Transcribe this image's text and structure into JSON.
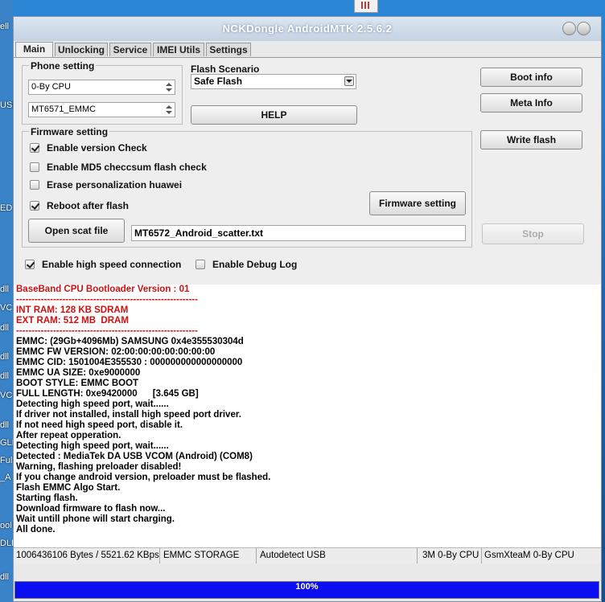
{
  "window": {
    "title": "NCKDongle AndroidMTK 2.5.6.2"
  },
  "tabs": [
    {
      "label": "Main"
    },
    {
      "label": "Unlocking"
    },
    {
      "label": "Service"
    },
    {
      "label": "IMEI Utils"
    },
    {
      "label": "Settings"
    }
  ],
  "phone_setting": {
    "label": "Phone setting",
    "cpu_value": "0-By CPU",
    "model_value": "MT6571_EMMC"
  },
  "flash_scenario": {
    "label": "Flash Scenario",
    "value": "Safe Flash"
  },
  "buttons": {
    "help": "HELP",
    "boot_info": "Boot info",
    "meta_info": "Meta Info",
    "write_flash": "Write flash",
    "firmware_setting": "Firmware setting",
    "open_scat_file": "Open scat file",
    "stop": "Stop"
  },
  "firmware_setting": {
    "label": "Firmware setting",
    "options": [
      {
        "label": "Enable version Check",
        "checked": true
      },
      {
        "label": "Enable MD5 checcsum flash check",
        "checked": false
      },
      {
        "label": "Erase personalization huawei",
        "checked": false
      },
      {
        "label": "Reboot after flash",
        "checked": true
      }
    ],
    "scatter_file": "MT6572_Android_scatter.txt"
  },
  "options": {
    "high_speed": {
      "label": "Enable high speed connection",
      "checked": true
    },
    "debug_log": {
      "label": "Enable Debug Log",
      "checked": false
    }
  },
  "log": [
    {
      "text": "BaseBand CPU Bootloader Version : 01",
      "red": true
    },
    {
      "text": "-----------------------------------------------------------",
      "red": true
    },
    {
      "text": "INT RAM: 128 KB SDRAM",
      "red": true
    },
    {
      "text": "EXT RAM: 512 MB  DRAM",
      "red": true
    },
    {
      "text": "-----------------------------------------------------------",
      "red": true
    },
    {
      "text": "EMMC: (29Gb+4096Mb) SAMSUNG 0x4e355530304d",
      "red": false
    },
    {
      "text": "EMMC FW VERSION: 02:00:00:00:00:00:00:00",
      "red": false
    },
    {
      "text": "EMMC CID: 1501004E355530 : 000000000000000000",
      "red": false
    },
    {
      "text": "EMMC UA SIZE: 0xe9000000",
      "red": false
    },
    {
      "text": "BOOT STYLE: EMMC BOOT",
      "red": false
    },
    {
      "text": "FULL LENGTH: 0xe9420000      [3.645 GB]",
      "red": false
    },
    {
      "text": "Detecting high speed port, wait......",
      "red": false
    },
    {
      "text": "If driver not installed, install high speed port driver.",
      "red": false
    },
    {
      "text": "If not need high speed port, disable it.",
      "red": false
    },
    {
      "text": "After repeat opperation.",
      "red": false
    },
    {
      "text": "Detecting high speed port, wait......",
      "red": false
    },
    {
      "text": "Detected : MediaTek DA USB VCOM (Android) (COM8)",
      "red": false
    },
    {
      "text": "Warning, flashing preloader disabled!",
      "red": false
    },
    {
      "text": "If you change android version, preloader must be flashed.",
      "red": false
    },
    {
      "text": "Flash EMMC Algo Start.",
      "red": false
    },
    {
      "text": "Starting flash.",
      "red": false
    },
    {
      "text": "Download firmware to flash now...",
      "red": false
    },
    {
      "text": "Wait untill phone will start charging.",
      "red": false
    },
    {
      "text": "All done.",
      "red": false
    }
  ],
  "status_bar": {
    "bytes": "1006436106 Bytes / 5521.62 KBps",
    "storage": "EMMC STORAGE",
    "usb": "Autodetect USB",
    "cpu": "3M 0-By CPU",
    "team": "GsmXteaM 0-By CPU"
  },
  "progress": {
    "label": "100%",
    "fraction": 1.0,
    "color": "#0a0ef0"
  },
  "desktop": {
    "left_labels": [
      "ell",
      "USE",
      "ED",
      "dll",
      "VC",
      "dll",
      "dll",
      "dll",
      "VC",
      "dll",
      "GLE",
      "Ful",
      "_A",
      "ool",
      "DLL",
      "dll"
    ]
  }
}
